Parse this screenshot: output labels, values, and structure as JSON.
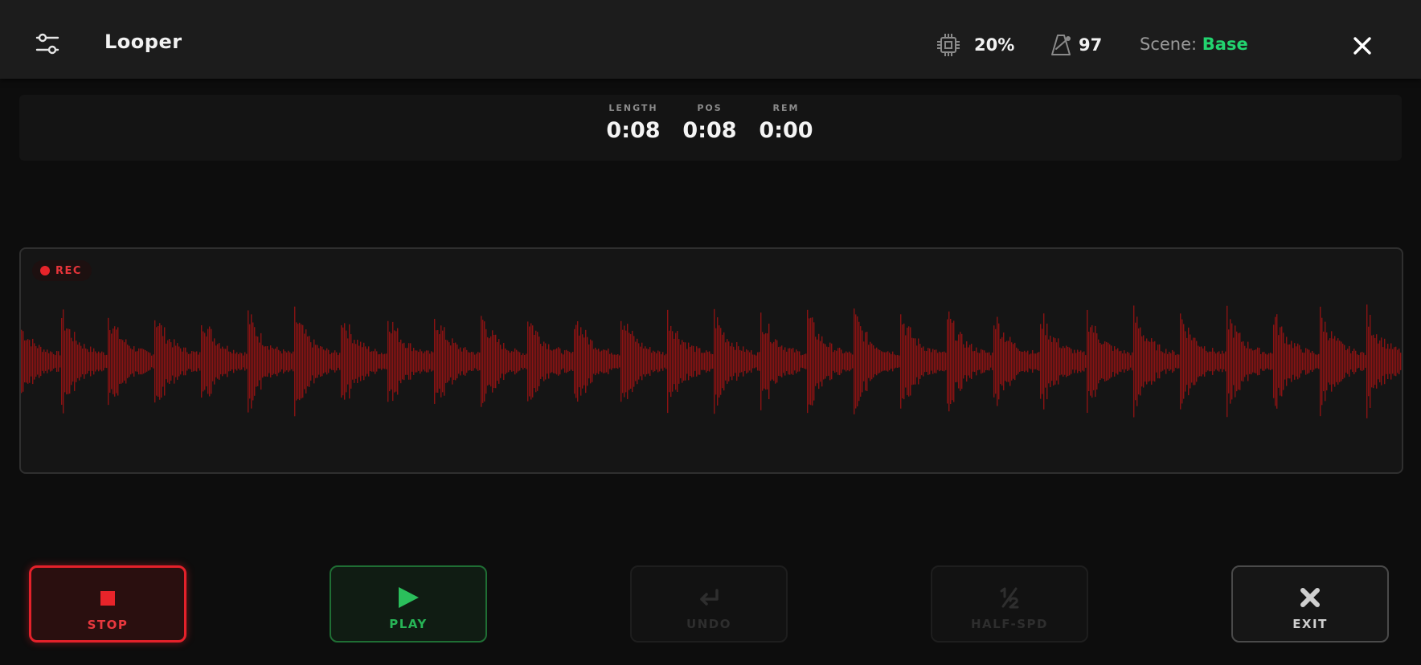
{
  "header": {
    "title": "Looper",
    "cpu": "20%",
    "tempo": "97",
    "scene_label": "Scene:",
    "scene_name": "Base"
  },
  "time": {
    "length_label": "LENGTH",
    "length_value": "0:08",
    "pos_label": "POS",
    "pos_value": "0:08",
    "rem_label": "REM",
    "rem_value": "0:00"
  },
  "waveform": {
    "state_label": "REC",
    "color": "#8a1313"
  },
  "controls": {
    "stop": "STOP",
    "play": "PLAY",
    "undo": "UNDO",
    "half_speed": "HALF-SPD",
    "exit": "EXIT"
  },
  "colors": {
    "accent_green": "#22d46f",
    "rec_red": "#e4212a"
  }
}
